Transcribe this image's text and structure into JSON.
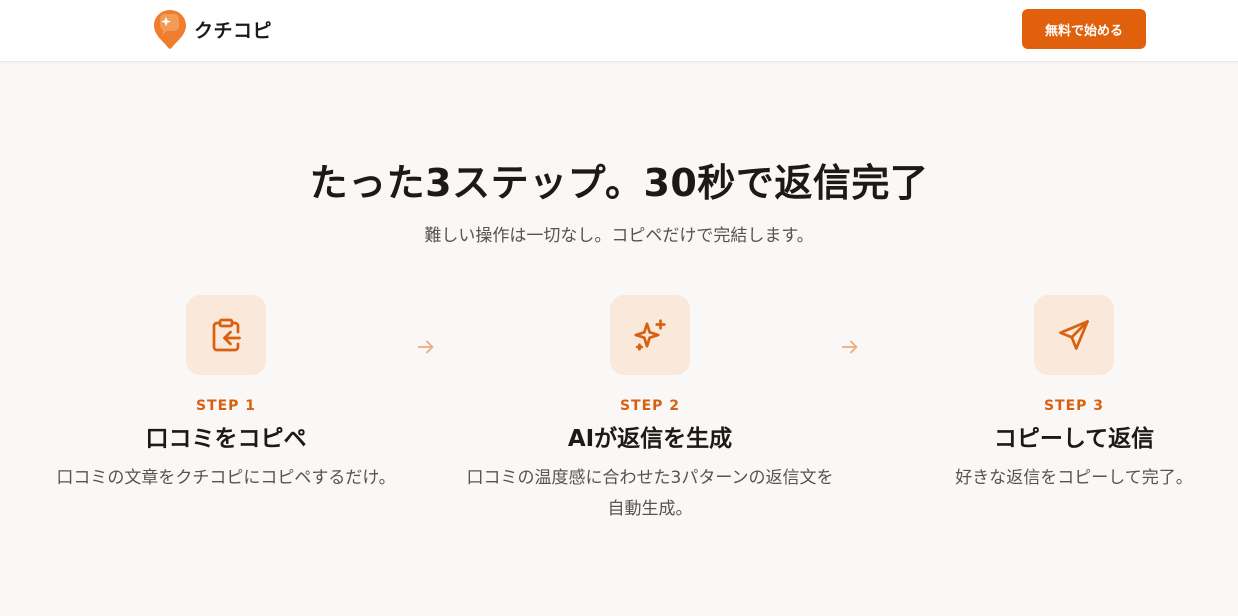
{
  "header": {
    "brand_name": "クチコピ",
    "cta_label": "無料で始める"
  },
  "hero": {
    "title": "たった3ステップ。30秒で返信完了",
    "subtitle": "難しい操作は一切なし。コピペだけで完結します。"
  },
  "steps": [
    {
      "icon": "clipboard-paste-icon",
      "label": "STEP 1",
      "title": "口コミをコピペ",
      "desc_lines": [
        "口コミの文章をクチコピにコピペするだけ。"
      ]
    },
    {
      "icon": "sparkles-icon",
      "label": "STEP 2",
      "title": "AIが返信を生成",
      "desc_lines": [
        "口コミの温度感に合わせた3パターンの返信文を",
        "自動生成。"
      ]
    },
    {
      "icon": "send-icon",
      "label": "STEP 3",
      "title": "コピーして返信",
      "desc_lines": [
        "好きな返信をコピーして完了。"
      ]
    }
  ],
  "colors": {
    "accent": "#e0600c",
    "icon_bg": "#fae9db",
    "page_bg": "#f9f8f6",
    "arrow": "#eda97a"
  }
}
